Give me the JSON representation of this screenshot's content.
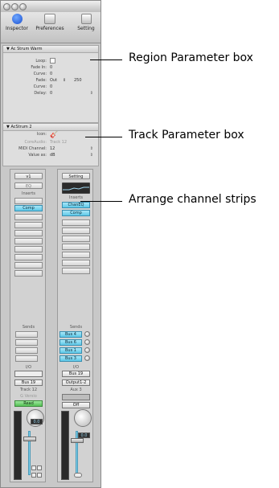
{
  "toolbar": {
    "items": [
      {
        "label": "Inspector",
        "icon": "info-icon"
      },
      {
        "label": "Preferences",
        "icon": "preferences-icon"
      },
      {
        "label": "Setting",
        "icon": "settings-icon"
      }
    ]
  },
  "region_panel": {
    "title": "Ac Strum Warm",
    "rows": {
      "loop": {
        "label": "Loop:"
      },
      "fade_in": {
        "label": "Fade In:",
        "value": "0"
      },
      "curve1": {
        "label": "Curve:",
        "value": "0"
      },
      "fade": {
        "label": "Fade:",
        "mode": "Out",
        "amount": "250"
      },
      "curve2": {
        "label": "Curve:",
        "value": "0"
      },
      "delay": {
        "label": "Delay:",
        "value": "0"
      }
    }
  },
  "track_panel": {
    "title": "AcStrum 2",
    "rows": {
      "icon": {
        "label": "Icon:"
      },
      "core_audio": {
        "label": "CoreAudio:",
        "value": "Track 12"
      },
      "midi_channel": {
        "label": "MIDI Channel:",
        "value": "12"
      },
      "value_as": {
        "label": "Value as:",
        "value": "dB"
      }
    }
  },
  "strip1": {
    "top_button": "v1",
    "eq": "EQ",
    "inserts_label": "Inserts",
    "insert_plugin": "Comp",
    "sends_label": "Sends",
    "io_label": "I/O",
    "io_value": "Bus 19",
    "track_name": "Track 12",
    "group_label": "G Versio",
    "automation": "Read",
    "volume": "0.0"
  },
  "strip2": {
    "top_button": "Setting",
    "inserts_label": "Inserts",
    "insert1": "ChanEQ",
    "insert2": "Comp",
    "sends_label": "Sends",
    "sends": [
      "Bus 4",
      "Bus 6",
      "Bus 1",
      "Bus 3"
    ],
    "io_label": "I/O",
    "io_input": "Bus 19",
    "io_output": "Output1-2",
    "track_name": "Aux 3",
    "automation": "Off",
    "volume": "0.0"
  },
  "callouts": {
    "region": "Region Parameter box",
    "track": "Track Parameter box",
    "strips": "Arrange channel strips"
  },
  "colors": {
    "insert_blue": "#5ec9e8",
    "read_green": "#55c055"
  }
}
